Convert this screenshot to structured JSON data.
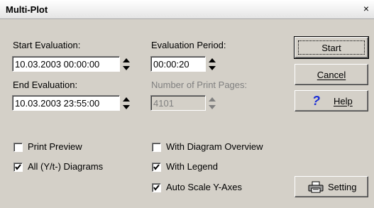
{
  "window": {
    "title": "Multi-Plot",
    "close_glyph": "×"
  },
  "fields": {
    "start_evaluation": {
      "label": "Start Evaluation:",
      "value": "10.03.2003 00:00:00"
    },
    "end_evaluation": {
      "label": "End Evaluation:",
      "value": "10.03.2003 23:55:00"
    },
    "evaluation_period": {
      "label": "Evaluation Period:",
      "value": "00:00:20"
    },
    "print_pages": {
      "label": "Number of Print Pages:",
      "value": "4101"
    }
  },
  "checkboxes": {
    "print_preview": {
      "label": "Print Preview",
      "checked": false
    },
    "all_diagrams": {
      "label": "All (Y/t-) Diagrams",
      "checked": true
    },
    "diagram_overview": {
      "label": "With Diagram Overview",
      "checked": false
    },
    "with_legend": {
      "label": "With Legend",
      "checked": true
    },
    "auto_scale": {
      "label": "Auto Scale Y-Axes",
      "checked": true
    }
  },
  "buttons": {
    "start": "Start",
    "cancel": "Cancel",
    "help": "Help",
    "setting": "Setting"
  },
  "icons": {
    "help": "question-mark",
    "setting": "printer"
  },
  "colors": {
    "face": "#d4d0c8",
    "help_icon": "#1c2fd6"
  }
}
